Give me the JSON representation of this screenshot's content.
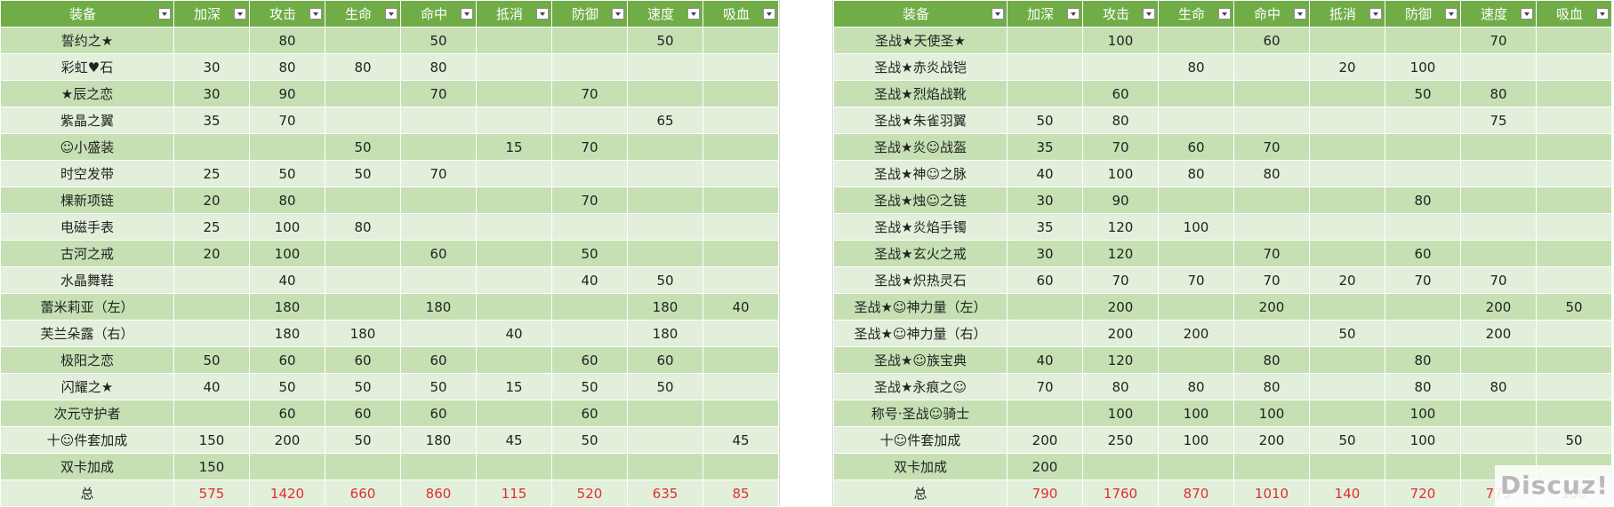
{
  "left_table": {
    "headers": [
      "装备",
      "加深",
      "攻击",
      "生命",
      "命中",
      "抵消",
      "防御",
      "速度",
      "吸血"
    ],
    "rows": [
      [
        "誓约之★",
        "",
        "80",
        "",
        "50",
        "",
        "",
        "50",
        ""
      ],
      [
        "彩虹♥石",
        "30",
        "80",
        "80",
        "80",
        "",
        "",
        "",
        ""
      ],
      [
        "★辰之恋",
        "30",
        "90",
        "",
        "70",
        "",
        "70",
        "",
        ""
      ],
      [
        "紫晶之翼",
        "35",
        "70",
        "",
        "",
        "",
        "",
        "65",
        ""
      ],
      [
        "☺小盛装",
        "",
        "",
        "50",
        "",
        "15",
        "70",
        "",
        ""
      ],
      [
        "时空发带",
        "25",
        "50",
        "50",
        "70",
        "",
        "",
        "",
        ""
      ],
      [
        "棵新项链",
        "20",
        "80",
        "",
        "",
        "",
        "70",
        "",
        ""
      ],
      [
        "电磁手表",
        "25",
        "100",
        "80",
        "",
        "",
        "",
        "",
        ""
      ],
      [
        "古河之戒",
        "20",
        "100",
        "",
        "60",
        "",
        "50",
        "",
        ""
      ],
      [
        "水晶舞鞋",
        "",
        "40",
        "",
        "",
        "",
        "40",
        "50",
        ""
      ],
      [
        "蕾米莉亚（左）",
        "",
        "180",
        "",
        "180",
        "",
        "",
        "180",
        "40"
      ],
      [
        "芙兰朵露（右）",
        "",
        "180",
        "180",
        "",
        "40",
        "",
        "180",
        ""
      ],
      [
        "极阳之恋",
        "50",
        "60",
        "60",
        "60",
        "",
        "60",
        "60",
        ""
      ],
      [
        "闪耀之★",
        "40",
        "50",
        "50",
        "50",
        "15",
        "50",
        "50",
        ""
      ],
      [
        "次元守护者",
        "",
        "60",
        "60",
        "60",
        "",
        "60",
        "",
        ""
      ],
      [
        "十☺件套加成",
        "150",
        "200",
        "50",
        "180",
        "45",
        "50",
        "",
        "45"
      ],
      [
        "双卡加成",
        "150",
        "",
        "",
        "",
        "",
        "",
        "",
        ""
      ],
      [
        "总",
        "575",
        "1420",
        "660",
        "860",
        "115",
        "520",
        "635",
        "85"
      ]
    ]
  },
  "right_table": {
    "headers": [
      "装备",
      "加深",
      "攻击",
      "生命",
      "命中",
      "抵消",
      "防御",
      "速度",
      "吸血"
    ],
    "rows": [
      [
        "圣战★天使圣★",
        "",
        "100",
        "",
        "60",
        "",
        "",
        "70",
        ""
      ],
      [
        "圣战★赤炎战铠",
        "",
        "",
        "80",
        "",
        "20",
        "100",
        "",
        ""
      ],
      [
        "圣战★烈焰战靴",
        "",
        "60",
        "",
        "",
        "",
        "50",
        "80",
        ""
      ],
      [
        "圣战★朱雀羽翼",
        "50",
        "80",
        "",
        "",
        "",
        "",
        "75",
        ""
      ],
      [
        "圣战★炎☺战盔",
        "35",
        "70",
        "60",
        "70",
        "",
        "",
        "",
        ""
      ],
      [
        "圣战★神☺之脉",
        "40",
        "100",
        "80",
        "80",
        "",
        "",
        "",
        ""
      ],
      [
        "圣战★烛☺之链",
        "30",
        "90",
        "",
        "",
        "",
        "80",
        "",
        ""
      ],
      [
        "圣战★炎焰手镯",
        "35",
        "120",
        "100",
        "",
        "",
        "",
        "",
        ""
      ],
      [
        "圣战★玄火之戒",
        "30",
        "120",
        "",
        "70",
        "",
        "60",
        "",
        ""
      ],
      [
        "圣战★炽热灵石",
        "60",
        "70",
        "70",
        "70",
        "20",
        "70",
        "70",
        ""
      ],
      [
        "圣战★☺神力量（左）",
        "",
        "200",
        "",
        "200",
        "",
        "",
        "200",
        "50"
      ],
      [
        "圣战★☺神力量（右）",
        "",
        "200",
        "200",
        "",
        "50",
        "",
        "200",
        ""
      ],
      [
        "圣战★☺族宝典",
        "40",
        "120",
        "",
        "80",
        "",
        "80",
        "",
        ""
      ],
      [
        "圣战★永痕之☺",
        "70",
        "80",
        "80",
        "80",
        "",
        "80",
        "80",
        ""
      ],
      [
        "称号·圣战☺骑士",
        "",
        "100",
        "100",
        "100",
        "",
        "100",
        "",
        ""
      ],
      [
        "十☺件套加成",
        "200",
        "250",
        "100",
        "200",
        "50",
        "100",
        "",
        "50"
      ],
      [
        "双卡加成",
        "200",
        "",
        "",
        "",
        "",
        "",
        "",
        ""
      ],
      [
        "总",
        "790",
        "1760",
        "870",
        "1010",
        "140",
        "720",
        "775",
        "100"
      ]
    ]
  },
  "watermark": "Discuz!",
  "colors": {
    "header_bg": "#70ad47",
    "row_dark": "#c6e0b4",
    "row_light": "#e2efda",
    "total_text": "#e03030"
  }
}
